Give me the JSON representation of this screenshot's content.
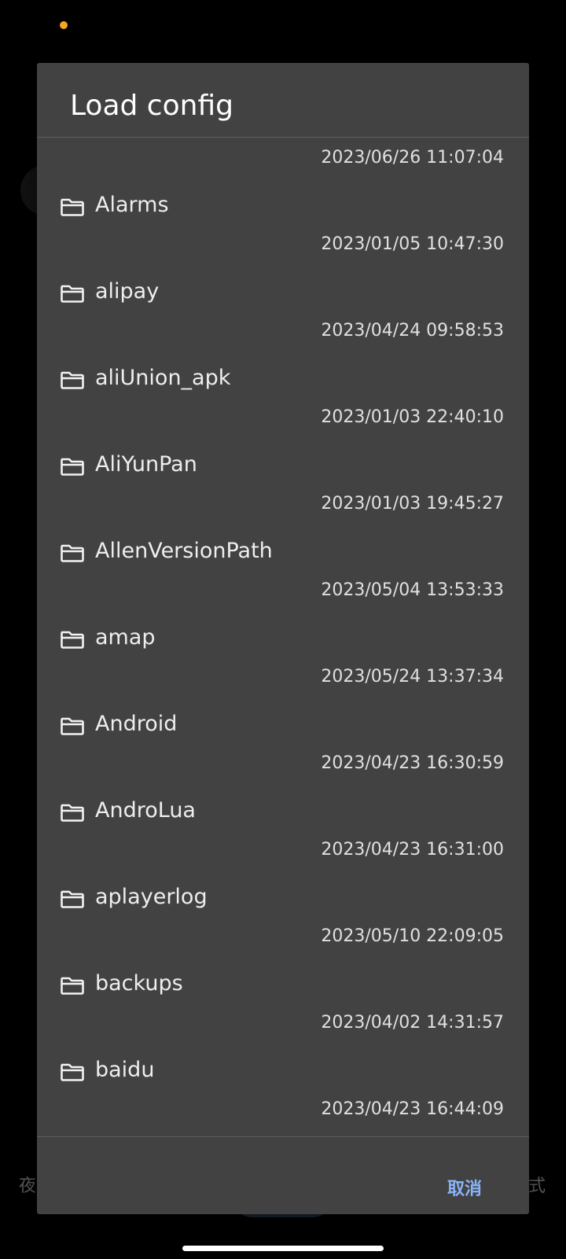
{
  "dialog": {
    "title": "Load config",
    "cancel_label": "取消"
  },
  "files": {
    "items": [
      {
        "name": "",
        "date": "2023/06/26 11:07:04",
        "icon": "folder-icon"
      },
      {
        "name": "Alarms",
        "date": "2023/01/05 10:47:30",
        "icon": "folder-icon"
      },
      {
        "name": "alipay",
        "date": "2023/04/24 09:58:53",
        "icon": "folder-icon"
      },
      {
        "name": "aliUnion_apk",
        "date": "2023/01/03 22:40:10",
        "icon": "folder-icon"
      },
      {
        "name": "AliYunPan",
        "date": "2023/01/03 19:45:27",
        "icon": "folder-icon"
      },
      {
        "name": "AllenVersionPath",
        "date": "2023/05/04 13:53:33",
        "icon": "folder-icon"
      },
      {
        "name": "amap",
        "date": "2023/05/24 13:37:34",
        "icon": "folder-icon"
      },
      {
        "name": "Android",
        "date": "2023/04/23 16:30:59",
        "icon": "folder-icon"
      },
      {
        "name": "AndroLua",
        "date": "2023/04/23 16:31:00",
        "icon": "folder-icon"
      },
      {
        "name": "aplayerlog",
        "date": "2023/05/10 22:09:05",
        "icon": "folder-icon"
      },
      {
        "name": "backups",
        "date": "2023/04/02 14:31:57",
        "icon": "folder-icon"
      },
      {
        "name": "baidu",
        "date": "2023/04/23 16:44:09",
        "icon": "folder-icon"
      }
    ]
  },
  "background": {
    "left_text": "夜",
    "right_text": "式"
  },
  "colors": {
    "dialog_bg": "#424242",
    "accent": "#8ab4f8",
    "status_dot": "#f5a623"
  }
}
